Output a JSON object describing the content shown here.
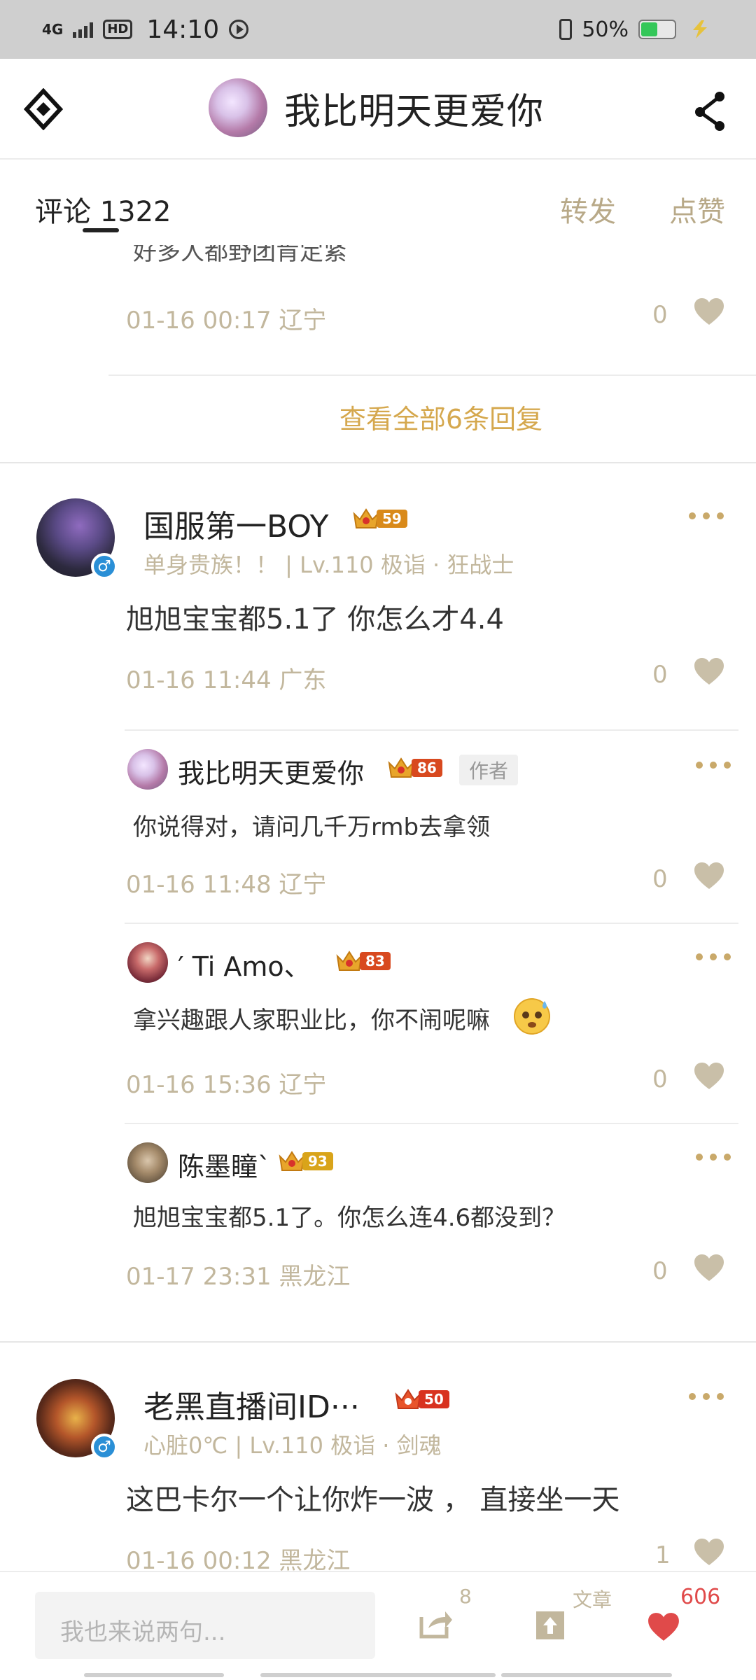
{
  "status_bar": {
    "network": "4G",
    "hd": "HD",
    "time": "14:10",
    "battery_pct": "50%",
    "battery_level": 0.5,
    "battery_color": "#34c759"
  },
  "header": {
    "title": "我比明天更爱你",
    "left_icon": "diamond-logo-icon",
    "right_icon": "share-icon"
  },
  "tabs": {
    "comments_label": "评论 1322",
    "forward_label": "转发",
    "like_label": "点赞"
  },
  "prev_thread": {
    "cut_text": "好多人都野团肯定紧",
    "meta": "01-16 00:17 辽宁",
    "likes": "0",
    "view_all": "查看全部6条回复"
  },
  "comments": [
    {
      "user": "国服第一BOY",
      "level_badge": "59",
      "subtitle": "单身贵族！！ | Lv.110 极诣 · 狂战士",
      "text": "旭旭宝宝都5.1了 你怎么才4.4",
      "meta": "01-16 11:44 广东",
      "likes": "0",
      "replies": [
        {
          "user": "我比明天更爱你",
          "level_badge": "86",
          "tag": "作者",
          "text": "你说得对，请问几千万rmb去拿领",
          "meta": "01-16 11:48 辽宁",
          "likes": "0"
        },
        {
          "user": "′ Ti Amo、",
          "level_badge": "83",
          "text": "拿兴趣跟人家职业比，你不闹呢嘛",
          "meta": "01-16 15:36 辽宁",
          "likes": "0"
        },
        {
          "user": "陈墨瞳`",
          "level_badge": "93",
          "text": "旭旭宝宝都5.1了。你怎么连4.6都没到？",
          "meta": "01-17 23:31 黑龙江",
          "likes": "0"
        }
      ]
    },
    {
      "user": "老黑直播间ID···",
      "level_badge": "50",
      "subtitle": "心脏0℃ | Lv.110 极诣 · 剑魂",
      "text": "这巴卡尔一个让你炸一波 ， 直接坐一天",
      "meta": "01-16 00:12 黑龙江",
      "likes": "1"
    }
  ],
  "bottom_bar": {
    "input_placeholder": "我也来说两句...",
    "forward_count": "8",
    "article_label": "文章",
    "like_count": "606"
  }
}
